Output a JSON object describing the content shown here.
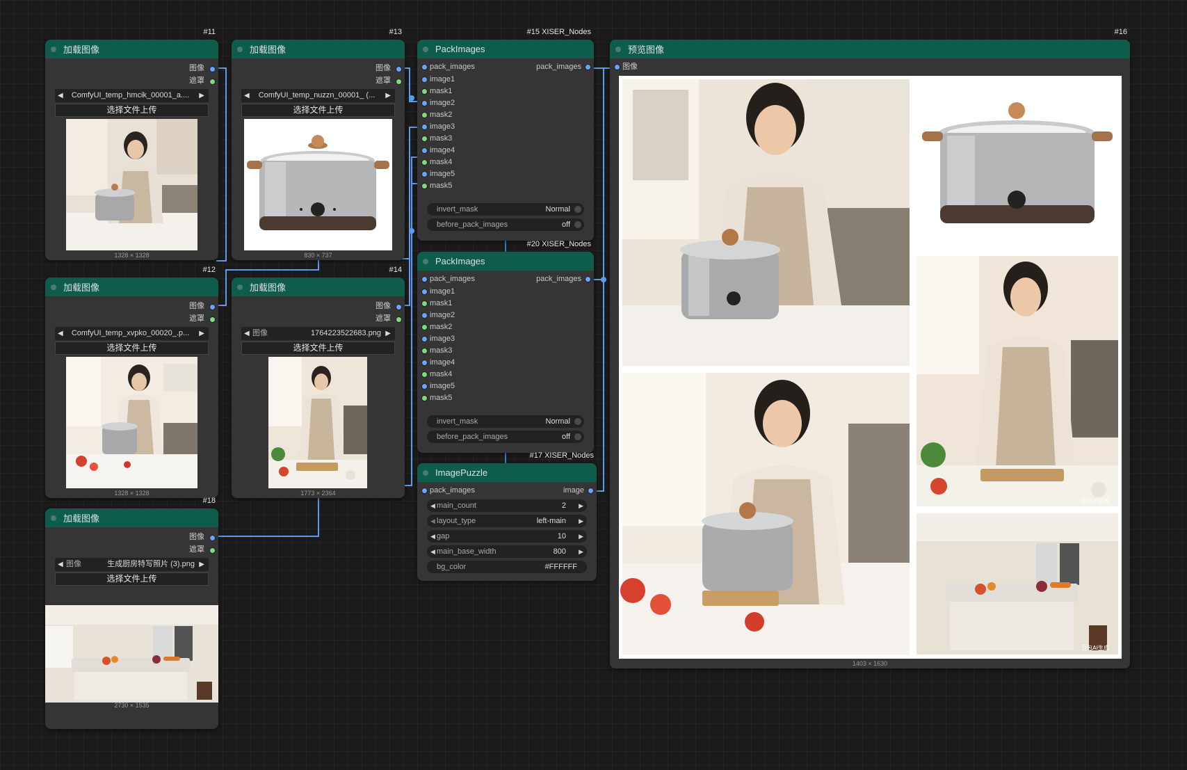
{
  "load_nodes": [
    {
      "id": "#11",
      "title": "加载图像",
      "output_image": "图像",
      "output_mask": "遮罩",
      "file_prefix": "",
      "file": "ComfyUI_temp_hmcik_00001_a....",
      "upload_label": "选择文件上传",
      "dims": "1328 × 1328",
      "scene": "woman-with-pot"
    },
    {
      "id": "#13",
      "title": "加载图像",
      "output_image": "图像",
      "output_mask": "遮罩",
      "file_prefix": "",
      "file": "ComfyUI_temp_nuzzn_00001_ (...",
      "upload_label": "选择文件上传",
      "dims": "830 × 737",
      "scene": "pot"
    },
    {
      "id": "#12",
      "title": "加载图像",
      "output_image": "图像",
      "output_mask": "遮罩",
      "file_prefix": "",
      "file": "ComfyUI_temp_xvpko_00020_.p...",
      "upload_label": "选择文件上传",
      "dims": "1328 × 1328",
      "scene": "woman-cooking"
    },
    {
      "id": "#14",
      "title": "加载图像",
      "output_image": "图像",
      "output_mask": "遮罩",
      "file_prefix": "图像",
      "file": "1764223522683.png",
      "upload_label": "选择文件上传",
      "dims": "1773 × 2364",
      "scene": "woman-cutting"
    },
    {
      "id": "#18",
      "title": "加载图像",
      "output_image": "图像",
      "output_mask": "遮罩",
      "file_prefix": "图像",
      "file": "生成厨房特写照片 (3).png",
      "upload_label": "选择文件上传",
      "dims": "2730 × 1535",
      "scene": "kitchen"
    }
  ],
  "pack_nodes": [
    {
      "id": "#15 XISER_Nodes",
      "title": "PackImages",
      "input_first": "pack_images",
      "output": "pack_images",
      "inputs": [
        "image1",
        "mask1",
        "image2",
        "mask2",
        "image3",
        "mask3",
        "image4",
        "mask4",
        "image5",
        "mask5"
      ],
      "widgets": [
        {
          "label": "invert_mask",
          "value": "Normal"
        },
        {
          "label": "before_pack_images",
          "value": "off"
        }
      ]
    },
    {
      "id": "#20 XISER_Nodes",
      "title": "PackImages",
      "input_first": "pack_images",
      "output": "pack_images",
      "inputs": [
        "image1",
        "mask1",
        "image2",
        "mask2",
        "image3",
        "mask3",
        "image4",
        "mask4",
        "image5",
        "mask5"
      ],
      "widgets": [
        {
          "label": "invert_mask",
          "value": "Normal"
        },
        {
          "label": "before_pack_images",
          "value": "off"
        }
      ]
    }
  ],
  "puzzle_node": {
    "id": "#17 XISER_Nodes",
    "title": "ImagePuzzle",
    "input": "pack_images",
    "output": "image",
    "widgets": [
      {
        "label": "main_count",
        "value": "2"
      },
      {
        "label": "layout_type",
        "value": "left-main"
      },
      {
        "label": "gap",
        "value": "10"
      },
      {
        "label": "main_base_width",
        "value": "800"
      },
      {
        "label": "bg_color",
        "value": "#FFFFFF"
      }
    ]
  },
  "preview_node": {
    "id": "#16",
    "title": "预览图像",
    "input": "图像",
    "dims": "1403 × 1630"
  },
  "colors": {
    "header": "#0f5c4d",
    "node": "#353535",
    "canvas": "#1a1a1a",
    "wire": "#5b9cf0",
    "slot_image": "#67a4ff",
    "slot_mask": "#7ddc7d",
    "watermark": "豆包AI生成"
  }
}
